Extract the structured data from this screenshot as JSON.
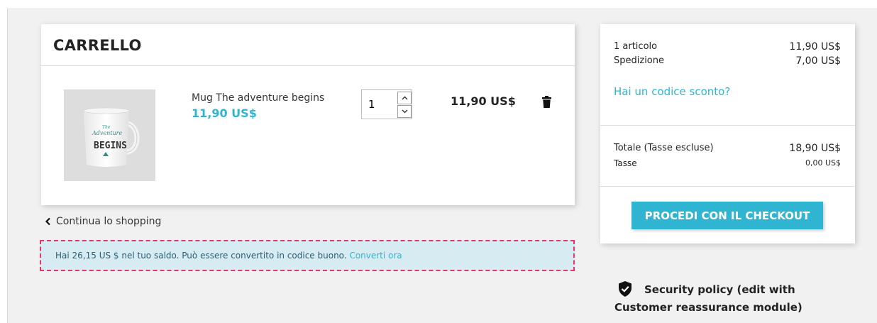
{
  "cart": {
    "title": "CARRELLO",
    "item": {
      "name": "Mug The adventure begins",
      "unit_price": "11,90 US$",
      "quantity": "1",
      "line_total": "11,90 US$",
      "image_text_line1": "The",
      "image_text_line2": "Adventure",
      "image_text_line3": "BEGINS"
    },
    "continue_label": "Continua lo shopping"
  },
  "notice": {
    "text": "Hai 26,15 US $ nel tuo saldo. Può essere convertito in codice buono. ",
    "link": "Converti ora"
  },
  "summary": {
    "items_label": "1 articolo",
    "items_value": "11,90 US$",
    "shipping_label": "Spedizione",
    "shipping_value": "7,00 US$",
    "discount_link": "Hai un codice sconto?",
    "total_label": "Totale (Tasse escluse)",
    "total_value": "18,90 US$",
    "tax_label": "Tasse",
    "tax_value": "0,00 US$",
    "checkout_label": "PROCEDI CON IL CHECKOUT"
  },
  "security": {
    "text": "Security policy (edit with Customer reassurance module)",
    "icon": "shield-check-icon"
  },
  "colors": {
    "accent": "#2fb5d2",
    "notice_bg": "#d6ebf2",
    "notice_border": "#e6356a"
  }
}
